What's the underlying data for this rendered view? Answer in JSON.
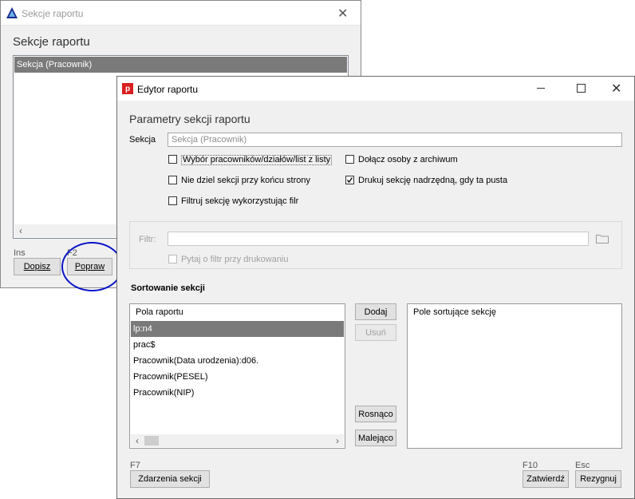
{
  "bg_window": {
    "title": "Sekcje raportu",
    "heading": "Sekcje raportu",
    "list_items": [
      "Sekcja (Pracownik)"
    ],
    "shortcut_add": "Ins",
    "shortcut_edit": "F2",
    "add_button": "Dopisz",
    "edit_button": "Popraw"
  },
  "editor": {
    "title": "Edytor raportu",
    "heading": "Parametry sekcji raportu",
    "section_label": "Sekcja",
    "section_value": "Sekcja (Pracownik)",
    "checkboxes": [
      {
        "label": "Wybór pracowników/działów/list z listy",
        "checked": false
      },
      {
        "label": "Dołącz osoby z archiwum",
        "checked": false
      },
      {
        "label": "Nie dziel sekcji przy końcu strony",
        "checked": false
      },
      {
        "label": "Drukuj sekcję nadrzędną, gdy ta pusta",
        "checked": true
      },
      {
        "label": "Filtruj sekcję wykorzystując filr",
        "checked": false
      }
    ],
    "filter_label": "Filtr:",
    "filter_value": "",
    "ask_filter_label": "Pytaj o filtr przy drukowaniu",
    "sort_heading": "Sortowanie sekcji",
    "report_fields_header": "Pola raportu",
    "report_fields": [
      "lp:n4",
      "prac$",
      "Pracownik(Data urodzenia):d06.",
      "Pracownik(PESEL)",
      "Pracownik(NIP)"
    ],
    "selected_field_index": 0,
    "sort_fields_header": "Pole sortujące sekcję",
    "add_button": "Dodaj",
    "remove_button": "Usuń",
    "asc_button": "Rosnąco",
    "desc_button": "Malejąco",
    "events_shortcut": "F7",
    "events_button": "Zdarzenia sekcji",
    "confirm_shortcut": "F10",
    "confirm_button": "Zatwierdź",
    "cancel_shortcut": "Esc",
    "cancel_button": "Rezygnuj"
  },
  "colors": {
    "selection": "#7a7a7a",
    "highlight_circle": "#0a14c8",
    "app_icon_red": "#d81e1e"
  }
}
